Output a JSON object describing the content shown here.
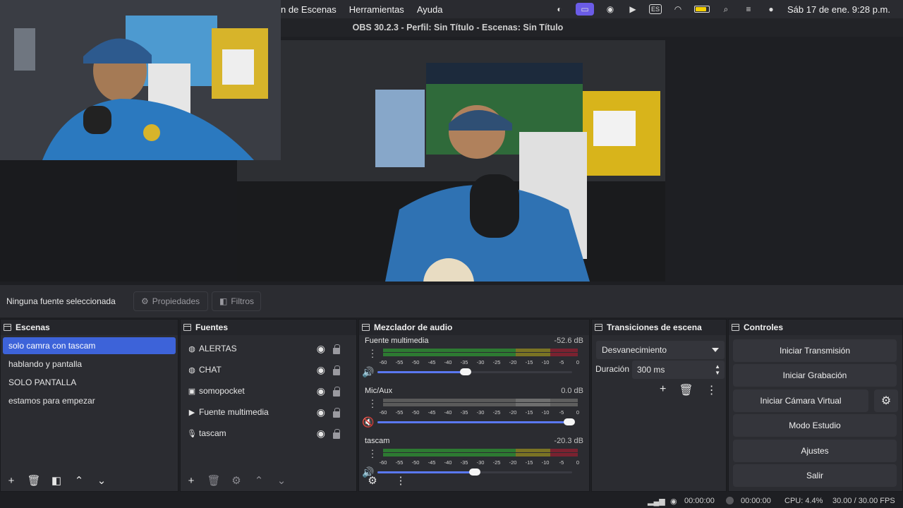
{
  "menubar": {
    "menus": [
      "n de Escenas",
      "Herramientas",
      "Ayuda"
    ],
    "input_source": "ES",
    "clock": "Sáb 17 de ene.  9:28 p.m."
  },
  "window": {
    "title": "OBS 30.2.3 - Perfil: Sin Título - Escenas: Sin Título"
  },
  "source_bar": {
    "none_selected": "Ninguna fuente seleccionada",
    "properties": "Propiedades",
    "filters": "Filtros"
  },
  "scenes": {
    "title": "Escenas",
    "items": [
      "solo camra con tascam",
      "hablando y pantalla",
      "SOLO PANTALLA",
      "estamos para empezar"
    ]
  },
  "sources": {
    "title": "Fuentes",
    "items": [
      {
        "label": "ALERTAS",
        "icon": "browser-icon"
      },
      {
        "label": "CHAT",
        "icon": "browser-icon"
      },
      {
        "label": "somopocket",
        "icon": "camera-icon"
      },
      {
        "label": "Fuente multimedia",
        "icon": "play-icon"
      },
      {
        "label": "tascam",
        "icon": "microphone-icon"
      }
    ]
  },
  "mixer": {
    "title": "Mezclador de audio",
    "ticks": [
      "-60",
      "-55",
      "-50",
      "-45",
      "-40",
      "-35",
      "-30",
      "-25",
      "-20",
      "-15",
      "-10",
      "-5",
      "0"
    ],
    "channels": [
      {
        "name": "Fuente multimedia",
        "db": "-52.6 dB",
        "volume": 0.45,
        "muted": false
      },
      {
        "name": "Mic/Aux",
        "db": "0.0 dB",
        "volume": 1.0,
        "muted": true
      },
      {
        "name": "tascam",
        "db": "-20.3 dB",
        "volume": 0.5,
        "muted": false
      }
    ]
  },
  "transitions": {
    "title": "Transiciones de escena",
    "selected": "Desvanecimiento",
    "duration_label": "Duración",
    "duration_value": "300 ms"
  },
  "controls": {
    "title": "Controles",
    "start_stream": "Iniciar Transmisión",
    "start_record": "Iniciar Grabación",
    "start_virtual_cam": "Iniciar Cámara Virtual",
    "studio_mode": "Modo Estudio",
    "settings": "Ajustes",
    "exit": "Salir"
  },
  "status": {
    "stream_time": "00:00:00",
    "rec_time": "00:00:00",
    "cpu": "CPU: 4.4%",
    "fps": "30.00 / 30.00 FPS"
  }
}
